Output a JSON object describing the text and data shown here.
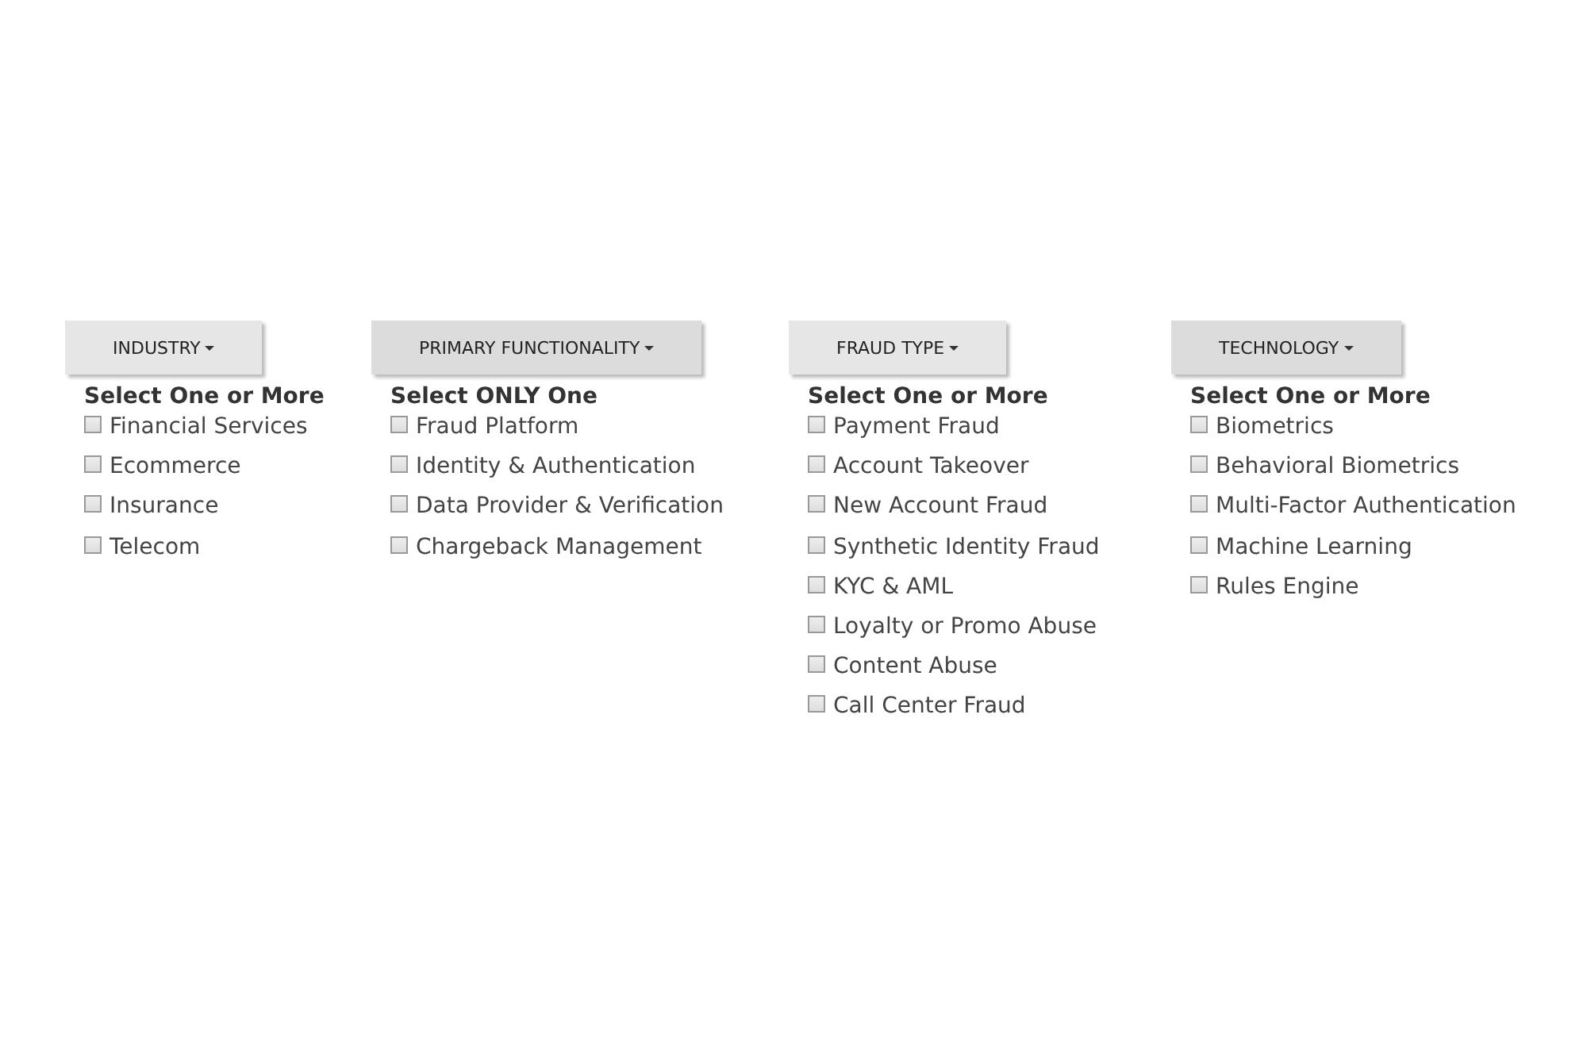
{
  "filters": [
    {
      "button": "INDUSTRY",
      "heading": "Select One or More",
      "options": [
        {
          "label": "Financial Services",
          "checked": false
        },
        {
          "label": "Ecommerce",
          "checked": false
        },
        {
          "label": "Insurance",
          "checked": false
        },
        {
          "label": "Telecom",
          "checked": false
        }
      ]
    },
    {
      "button": "PRIMARY FUNCTIONALITY",
      "heading": "Select ONLY One",
      "options": [
        {
          "label": "Fraud Platform",
          "checked": false
        },
        {
          "label": "Identity & Authentication",
          "checked": false
        },
        {
          "label": "Data Provider & Verification",
          "checked": false
        },
        {
          "label": "Chargeback Management",
          "checked": false
        }
      ]
    },
    {
      "button": "FRAUD TYPE",
      "heading": "Select One or More",
      "options": [
        {
          "label": "Payment Fraud",
          "checked": false
        },
        {
          "label": "Account Takeover",
          "checked": false
        },
        {
          "label": "New Account Fraud",
          "checked": false
        },
        {
          "label": "Synthetic Identity Fraud",
          "checked": false
        },
        {
          "label": "KYC & AML",
          "checked": false
        },
        {
          "label": "Loyalty or Promo Abuse",
          "checked": false
        },
        {
          "label": "Content Abuse",
          "checked": false
        },
        {
          "label": "Call Center Fraud",
          "checked": false
        }
      ]
    },
    {
      "button": "TECHNOLOGY",
      "heading": "Select One or More",
      "options": [
        {
          "label": "Biometrics",
          "checked": false
        },
        {
          "label": "Behavioral Biometrics",
          "checked": false
        },
        {
          "label": "Multi-Factor Authentication",
          "checked": false
        },
        {
          "label": "Machine Learning",
          "checked": false
        },
        {
          "label": "Rules Engine",
          "checked": false
        }
      ]
    }
  ]
}
